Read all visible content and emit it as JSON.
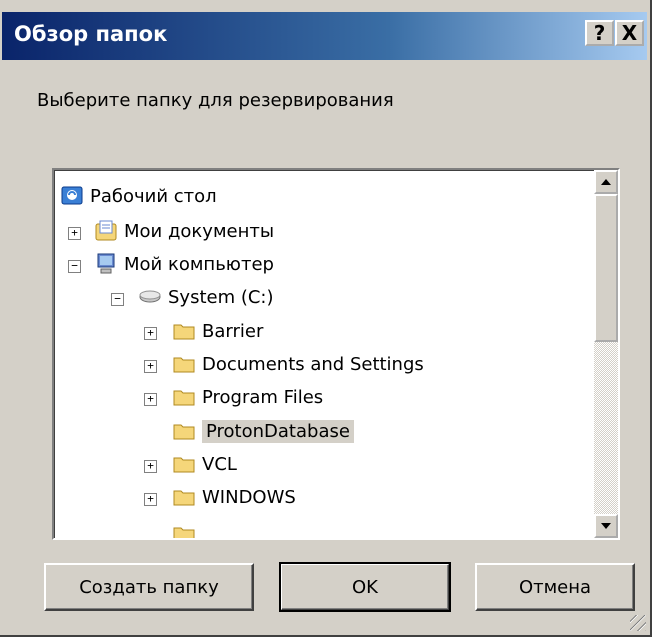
{
  "dialog": {
    "title": "Обзор папок",
    "help_label": "?",
    "close_label": "X",
    "prompt": "Выберите папку для резервирования"
  },
  "tree": {
    "items": [
      {
        "label": "Рабочий стол",
        "icon": "desktop-icon",
        "expander": ""
      },
      {
        "label": "Мои документы",
        "icon": "my-documents-icon",
        "expander": "+"
      },
      {
        "label": "Мой компьютер",
        "icon": "my-computer-icon",
        "expander": "−"
      },
      {
        "label": "System (C:)",
        "icon": "drive-icon",
        "expander": "−"
      },
      {
        "label": "Barrier",
        "icon": "folder-icon",
        "expander": "+"
      },
      {
        "label": "Documents and Settings",
        "icon": "folder-icon",
        "expander": "+"
      },
      {
        "label": "Program Files",
        "icon": "folder-icon",
        "expander": "+"
      },
      {
        "label": "ProtonDatabase",
        "icon": "folder-icon",
        "expander": "",
        "selected": true
      },
      {
        "label": "VCL",
        "icon": "folder-icon",
        "expander": "+"
      },
      {
        "label": "WINDOWS",
        "icon": "folder-icon",
        "expander": "+"
      }
    ]
  },
  "buttons": {
    "new_folder": "Создать папку",
    "ok": "OK",
    "cancel": "Отмена"
  },
  "colors": {
    "title_start": "#0a246a",
    "title_end": "#a6caf0",
    "face": "#d4d0c8",
    "folder": "#f5d67a"
  }
}
